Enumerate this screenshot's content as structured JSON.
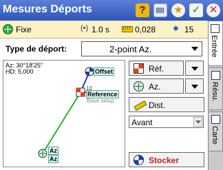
{
  "window": {
    "title": "Mesures Déports",
    "help_glyph": "?",
    "star_glyph": "★",
    "check_glyph": "✓",
    "close_glyph": "✕"
  },
  "status": {
    "fix": "Fixe",
    "radio_glyph": "(•)",
    "interval": "1.0 s",
    "precision": "0,028",
    "sat_glyph": "✷",
    "satellites": "15"
  },
  "tabs": [
    {
      "label": "Entrée",
      "icon": "entry-icon",
      "active": true
    },
    {
      "label": "Résu.",
      "icon": "results-icon",
      "active": false
    },
    {
      "label": "Carte",
      "icon": "map-icon",
      "active": false
    }
  ],
  "form": {
    "type_label": "Type de déport:",
    "type_value": "2-point Az."
  },
  "map": {
    "az_readout": "Az: 30°18'25\"",
    "hd_readout": "HD: 5,000",
    "offset_label": "Offset",
    "reference_label": "Reference",
    "base_setup_label": "Base setup",
    "point_label_10": "10",
    "az_label_1": "Az",
    "az_label_2": "Az"
  },
  "buttons": {
    "ref": "Réf.",
    "az": "Az.",
    "dist": "Dist.",
    "direction": "Avant",
    "store": "Stocker"
  },
  "colors": {
    "titlebar": "#2f56b8",
    "status_bg": "#fbf3c5",
    "store_text": "#d01818",
    "line_blue": "#1b3ea8",
    "line_green": "#22b52a"
  }
}
